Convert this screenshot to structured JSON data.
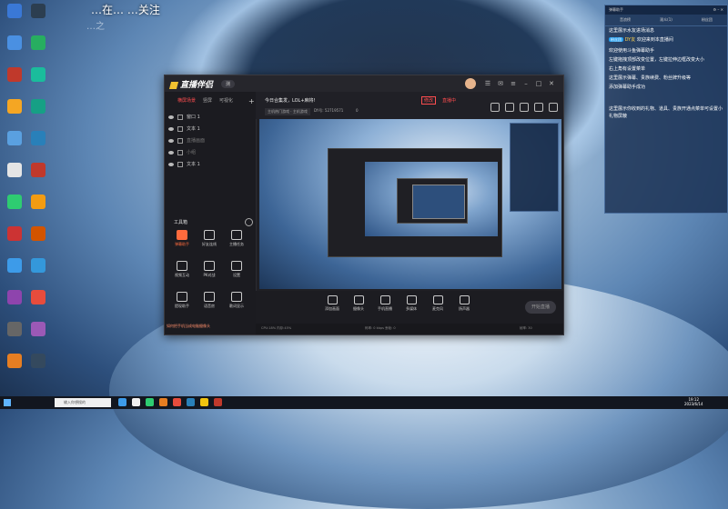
{
  "overlay": {
    "top_text": "…在… …关注",
    "watermark": "…之"
  },
  "desktop_icons": [
    {
      "label": "",
      "color": "#3a78d6"
    },
    {
      "label": "",
      "color": "#4a90e2"
    },
    {
      "label": "",
      "color": "#c0392b"
    },
    {
      "label": "",
      "color": "#f5a623"
    },
    {
      "label": "",
      "color": "#5aa0e0"
    },
    {
      "label": "",
      "color": "#e5e5e5"
    },
    {
      "label": "",
      "color": "#2ecc71"
    },
    {
      "label": "",
      "color": "#cc3333"
    },
    {
      "label": "",
      "color": "#3d9be9"
    },
    {
      "label": "",
      "color": "#8e44ad"
    },
    {
      "label": "",
      "color": "#666666"
    },
    {
      "label": "",
      "color": "#e67e22"
    },
    {
      "label": "",
      "color": "#2c3e50"
    },
    {
      "label": "",
      "color": "#27ae60"
    },
    {
      "label": "",
      "color": "#1abc9c"
    },
    {
      "label": "",
      "color": "#16a085"
    },
    {
      "label": "",
      "color": "#2980b9"
    },
    {
      "label": "",
      "color": "#c0392b"
    },
    {
      "label": "",
      "color": "#f39c12"
    },
    {
      "label": "",
      "color": "#d35400"
    },
    {
      "label": "",
      "color": "#3498db"
    },
    {
      "label": "",
      "color": "#e74c3c"
    },
    {
      "label": "",
      "color": "#9b59b6"
    },
    {
      "label": "",
      "color": "#34495e"
    }
  ],
  "app": {
    "logo_text": "直播伴侣",
    "version_badge": "测",
    "sidebar": {
      "tabs": [
        "横屏场景",
        "竖屏",
        "可视化"
      ],
      "scenes": [
        {
          "name": "窗口 1",
          "dim": false
        },
        {
          "name": "文本 1",
          "dim": false
        },
        {
          "name": "直播画面",
          "dim": true
        },
        {
          "name": "小组",
          "dim": true
        },
        {
          "name": "文本 1",
          "dim": false
        }
      ],
      "tools_title": "工具箱",
      "tools": [
        {
          "label": "弹幕助手",
          "hot": true
        },
        {
          "label": "好友连线",
          "hot": false
        },
        {
          "label": "主播任务",
          "hot": false
        },
        {
          "label": "视频互动",
          "hot": false
        },
        {
          "label": "PK对战",
          "hot": false
        },
        {
          "label": "设置",
          "hot": false
        },
        {
          "label": "提现助手",
          "hot": false
        },
        {
          "label": "语音房",
          "hot": false
        },
        {
          "label": "歌词显示",
          "hot": false
        }
      ],
      "tip": "如何把手机当成电脑摄像头"
    },
    "header": {
      "room_title": "今日合集发，LOL+麻将!",
      "edit_label": "修改",
      "live_tag": "直播中",
      "category": "主机热门游戏 · 主机游戏",
      "room_id": "DY号: 52719571",
      "followers": "0"
    },
    "bottom_bar": [
      {
        "label": "添加画面"
      },
      {
        "label": "摄像头"
      },
      {
        "label": "手机直播"
      },
      {
        "label": "多媒体"
      },
      {
        "label": "麦克风"
      },
      {
        "label": "扬声器"
      }
    ],
    "start_live": "开始直播",
    "status": {
      "left": "CPU:18% 内存:45%",
      "middle": "码率: 0 kbps  丢帧: 0",
      "right": "帧率: 30"
    }
  },
  "chat": {
    "title": "弹幕助手",
    "stats": [
      "音浪榜",
      "观众(1)",
      "粉丝团"
    ],
    "messages": [
      {
        "text": "这里展示水友进场消息"
      },
      {
        "level": "粉丝团",
        "user": "DY友",
        "text": "欢迎来到本直播间"
      },
      {
        "text": ""
      },
      {
        "text": "欢迎使用斗鱼弹幕助手"
      },
      {
        "text": "左键拖拽顶部改变位置，左键拉伸边框改变大小"
      },
      {
        "text": "右上角有设置菜单"
      },
      {
        "text": "这里展示弹幕、贵族续费、粉丝牌升级等"
      },
      {
        "text": "添加弹幕助手成功"
      }
    ],
    "gift_hint": "这里展示你收到的礼物、道具、贵族开通点菜单可设置小礼物屏蔽"
  },
  "taskbar": {
    "search_placeholder": "输入你想搜的",
    "apps": [
      {
        "color": "#3d9be9"
      },
      {
        "color": "#f0f0f0"
      },
      {
        "color": "#2ecc71"
      },
      {
        "color": "#e67e22"
      },
      {
        "color": "#e74c3c"
      },
      {
        "color": "#2980b9"
      },
      {
        "color": "#f1c40f"
      },
      {
        "color": "#c0392b"
      }
    ],
    "time": "19:12",
    "date": "2023/6/14"
  },
  "colors": {
    "accent": "#ff4d4f",
    "tool_hot": "#ff6b3d",
    "chat_bg": "#182e50",
    "app_bg": "#1f1f24"
  }
}
